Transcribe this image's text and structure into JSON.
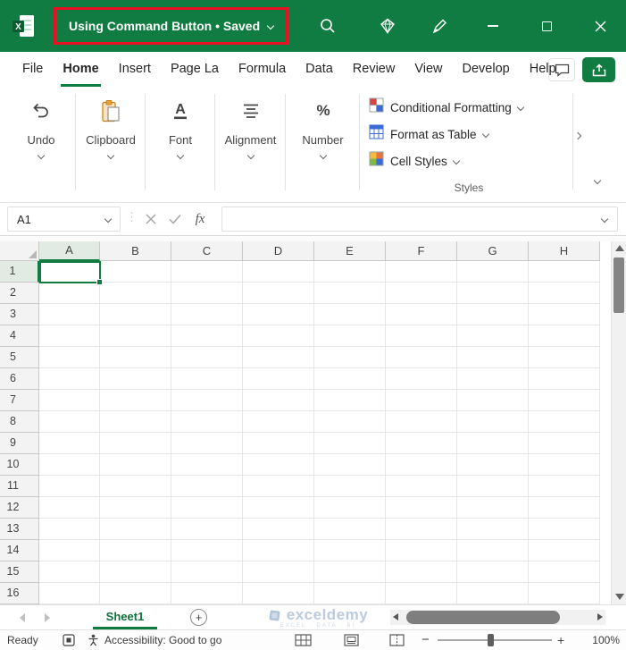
{
  "title_bar": {
    "title": "Using Command Button • Saved"
  },
  "menu": {
    "tabs": [
      {
        "label": "File",
        "active": false
      },
      {
        "label": "Home",
        "active": true
      },
      {
        "label": "Insert",
        "active": false
      },
      {
        "label": "Page La",
        "active": false
      },
      {
        "label": "Formula",
        "active": false
      },
      {
        "label": "Data",
        "active": false
      },
      {
        "label": "Review",
        "active": false
      },
      {
        "label": "View",
        "active": false
      },
      {
        "label": "Develop",
        "active": false
      },
      {
        "label": "Help",
        "active": false
      }
    ]
  },
  "ribbon": {
    "groups": [
      {
        "name": "undo",
        "label": "Undo"
      },
      {
        "name": "clipboard",
        "label": "Clipboard"
      },
      {
        "name": "font",
        "label": "Font"
      },
      {
        "name": "alignment",
        "label": "Alignment"
      },
      {
        "name": "number",
        "label": "Number"
      }
    ],
    "styles": {
      "items": [
        {
          "label": "Conditional Formatting"
        },
        {
          "label": "Format as Table"
        },
        {
          "label": "Cell Styles"
        }
      ],
      "group_label": "Styles"
    }
  },
  "formula_bar": {
    "name_box": "A1",
    "fx_label": "fx",
    "formula_value": ""
  },
  "grid": {
    "columns": [
      "A",
      "B",
      "C",
      "D",
      "E",
      "F",
      "G",
      "H"
    ],
    "rows": [
      "1",
      "2",
      "3",
      "4",
      "5",
      "6",
      "7",
      "8",
      "9",
      "10",
      "11",
      "12",
      "13",
      "14",
      "15",
      "16"
    ],
    "selected": {
      "col": "A",
      "row": "1",
      "cell": "A1"
    }
  },
  "sheet_bar": {
    "tabs": [
      {
        "label": "Sheet1",
        "active": true
      }
    ],
    "add_label": "+",
    "watermark": {
      "name": "exceldemy",
      "tagline": "EXCEL · DATA · BI"
    }
  },
  "status_bar": {
    "ready": "Ready",
    "accessibility": "Accessibility: Good to go",
    "zoom_out": "−",
    "zoom_in": "+",
    "zoom": "100%"
  },
  "icons": {
    "title_bar": [
      "excel-logo",
      "search",
      "diamond",
      "pen",
      "minimize",
      "maximize",
      "close"
    ],
    "menu_right": [
      "comment",
      "share"
    ],
    "ribbon": [
      "undo",
      "clipboard",
      "font",
      "alignment",
      "number",
      "conditional-formatting",
      "format-as-table",
      "cell-styles"
    ],
    "status_bar": [
      "macro-record",
      "accessibility",
      "normal-view",
      "page-layout-view",
      "page-break-view"
    ]
  },
  "colors": {
    "excel_green": "#107C41",
    "annotation_red": "#E81123",
    "selection_green": "#107C41",
    "watermark_blue": "#A9BFD9"
  }
}
